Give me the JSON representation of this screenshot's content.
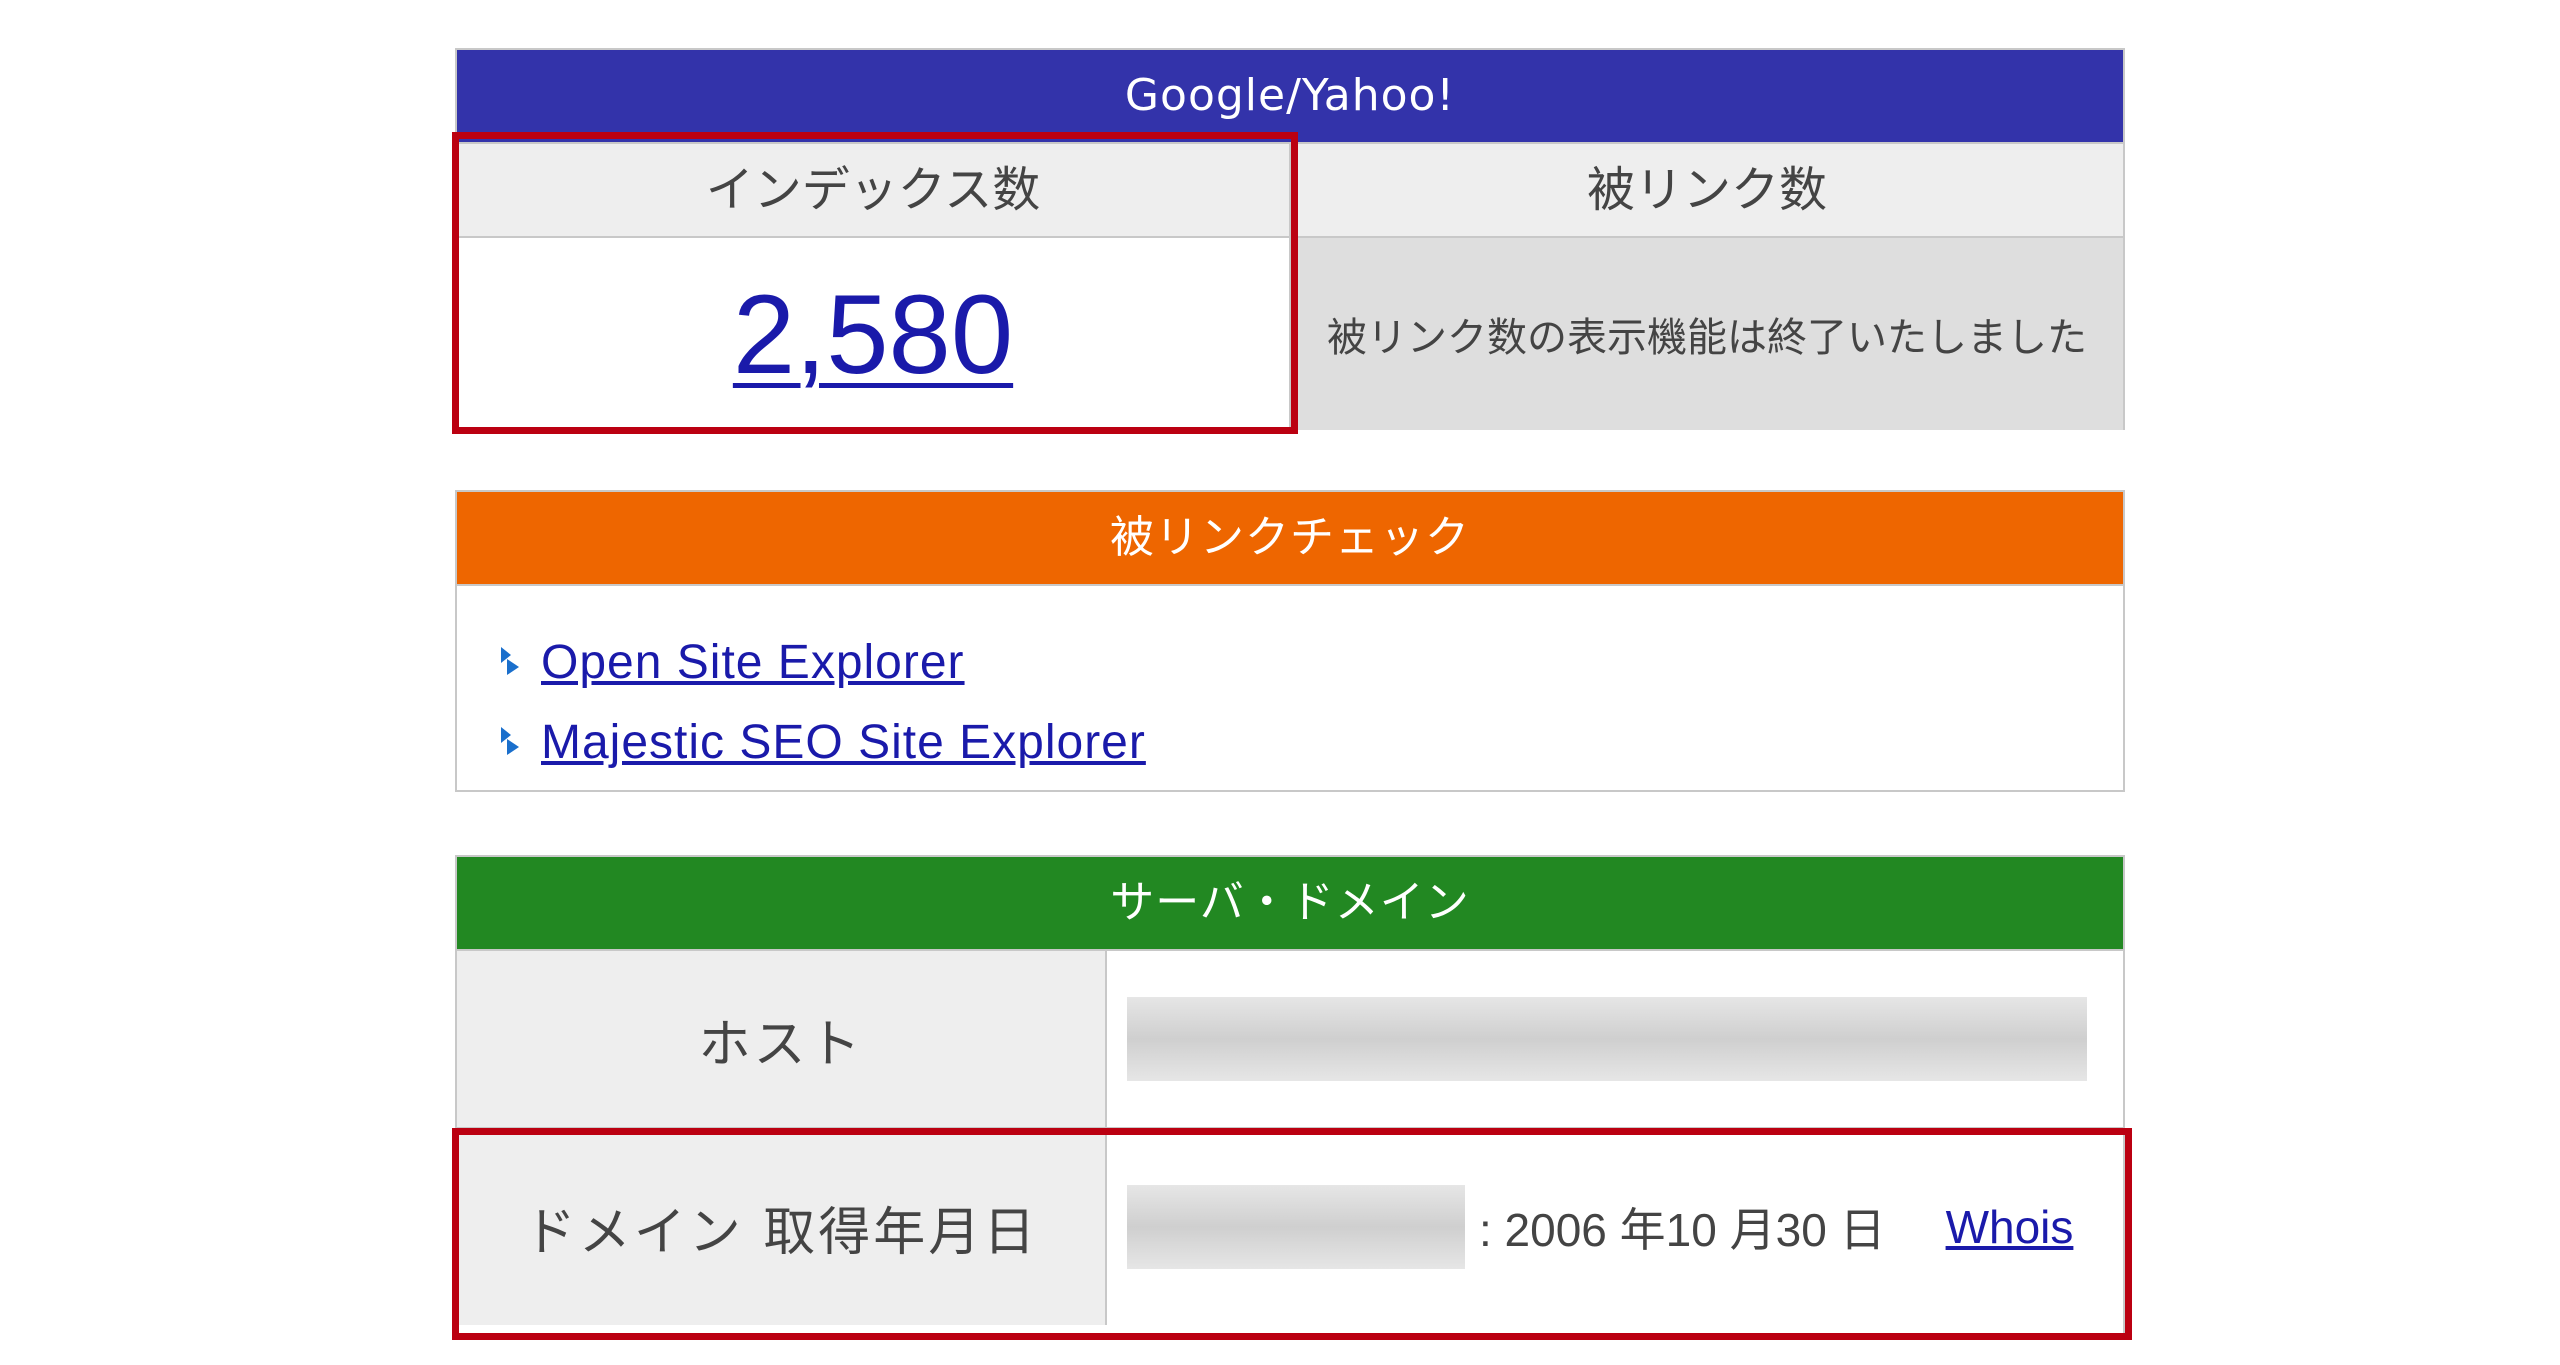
{
  "google_panel": {
    "title": "Google/Yahoo!",
    "index_label": "インデックス数",
    "backlink_label": "被リンク数",
    "index_value": "2,580",
    "backlink_message": "被リンク数の表示機能は終了いたしました",
    "header_color": "#3333aa"
  },
  "backlink_panel": {
    "title": "被リンクチェック",
    "header_color": "#ee6600",
    "links": [
      {
        "label": "Open Site Explorer",
        "icon": "chevron-bullet-icon"
      },
      {
        "label": "Majestic SEO Site Explorer",
        "icon": "chevron-bullet-icon"
      }
    ]
  },
  "server_panel": {
    "title": "サーバ・ドメイン",
    "header_color": "#228822",
    "host_label": "ホスト",
    "domain_label": "ドメイン 取得年月日",
    "domain_date": ": 2006 年10 月30 日",
    "whois_label": "Whois"
  },
  "highlight_color": "#bb0011"
}
